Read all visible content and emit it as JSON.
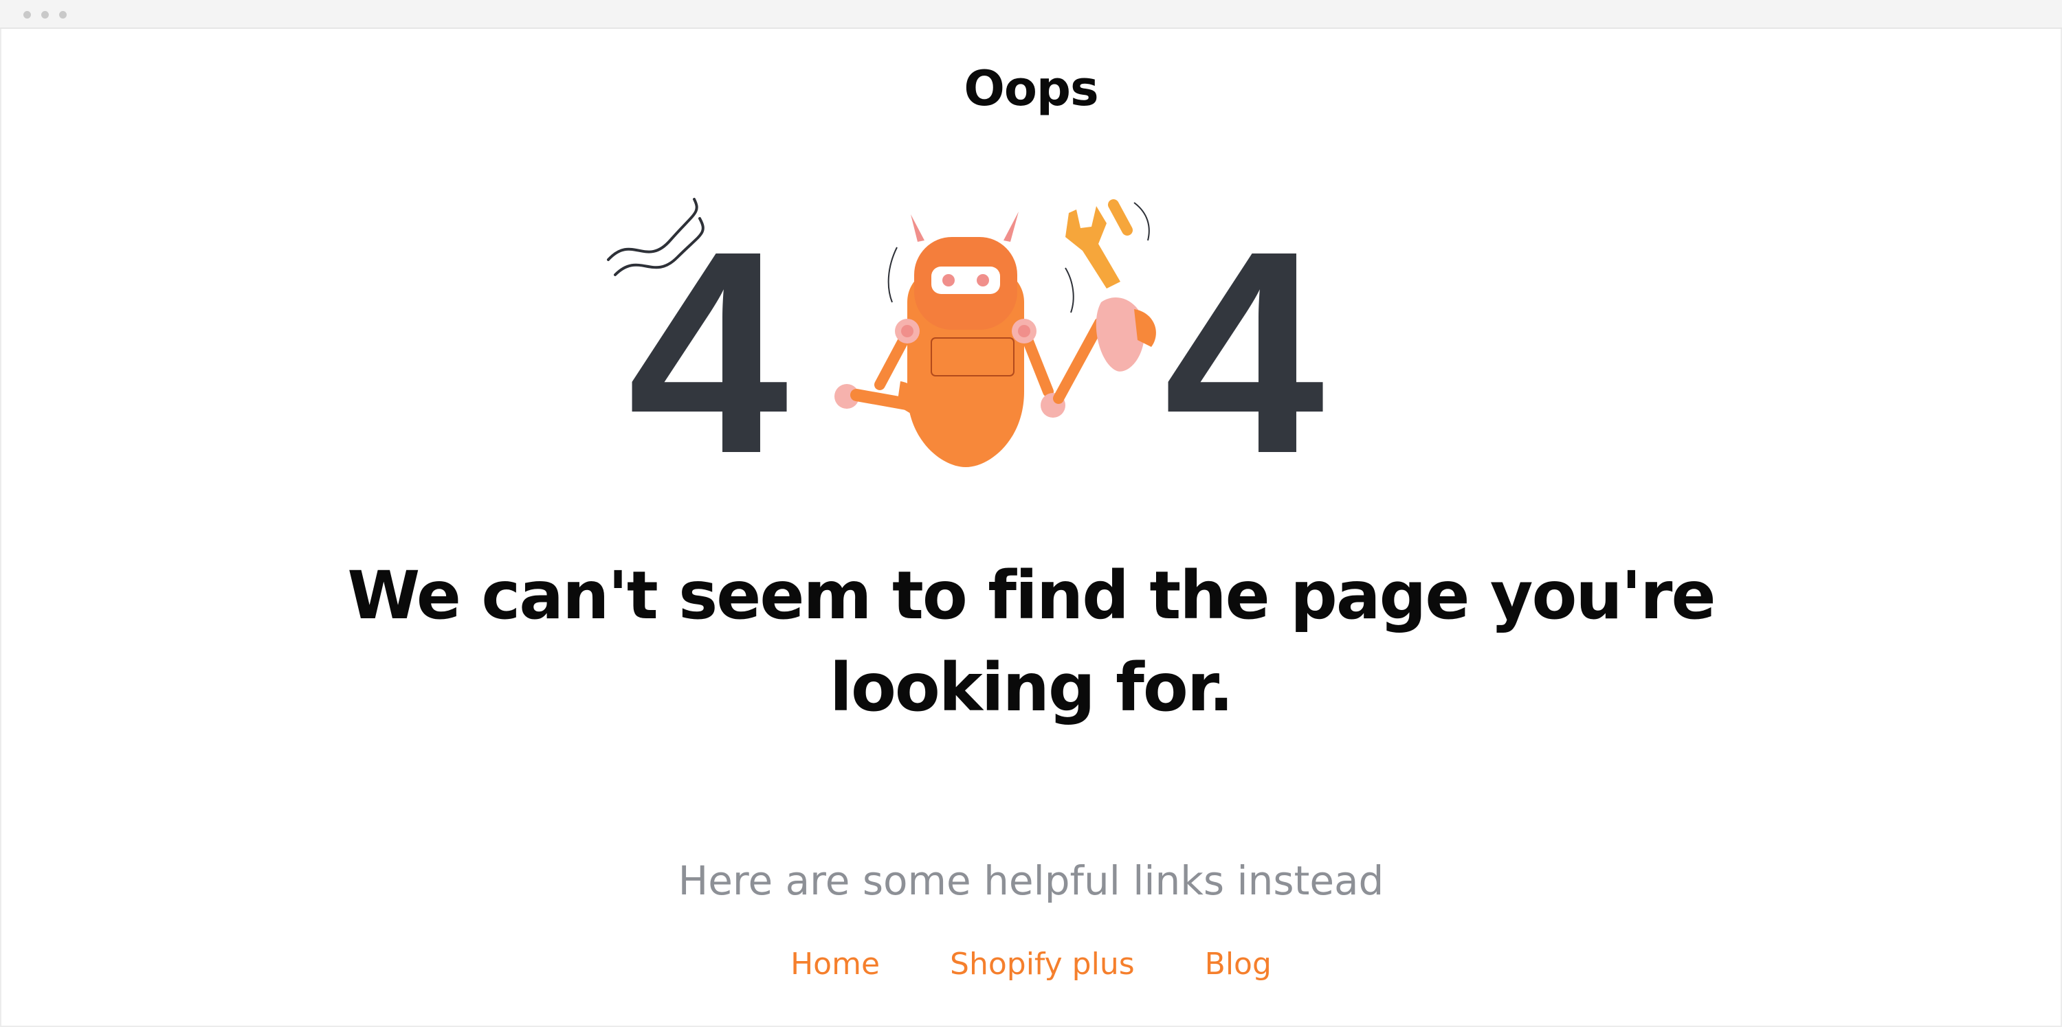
{
  "page": {
    "heading": "Oops",
    "illustration": {
      "digit_left": "4",
      "digit_right": "4"
    },
    "message_line1": "We can't seem to find the page you're",
    "message_line2": "looking for.",
    "helpful_text": "Here are some helpful links instead",
    "links": [
      {
        "label": "Home"
      },
      {
        "label": "Shopify plus"
      },
      {
        "label": "Blog"
      }
    ]
  },
  "colors": {
    "accent": "#f57f2c",
    "robot_orange": "#f7883a",
    "digit_dark": "#33373e",
    "muted_text": "#8d9096"
  },
  "icons": [
    "window-dot-icon",
    "robot-illustration",
    "wrench-icon",
    "scribble-icon"
  ]
}
